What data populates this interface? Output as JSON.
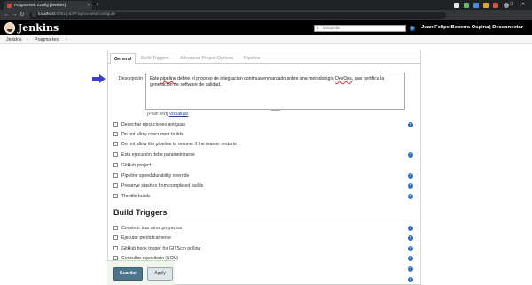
{
  "browser": {
    "tab_title": "Pragma-test Config [Jenkins]",
    "tab_close": "×",
    "new_tab": "+",
    "window_controls": [
      "—",
      "☐",
      "✕"
    ],
    "url_host": "localhost",
    "url_path": ":8081/job/Pragma-test/configure",
    "back": "←",
    "forward": "→",
    "reload": "↻",
    "info_icon": "ⓘ"
  },
  "header": {
    "logo_text": "Jenkins",
    "search_placeholder": "búsqueda",
    "search_icon": "⌕",
    "help": "?",
    "user": "Juan Felipe Becerra Ospina",
    "logout": "| Desconectar"
  },
  "breadcrumb": {
    "items": [
      "Jenkins",
      "Pragma-test"
    ],
    "separator": "›"
  },
  "tabs": [
    "General",
    "Build Triggers",
    "Advanced Project Options",
    "Pipeline"
  ],
  "description": {
    "label": "Descripción",
    "text_parts": [
      "Este ",
      "pipeline",
      " define el proceso de integración continua enmarcado sobre una metodología ",
      "DevOps",
      ", que certifica la generación de software de calidad."
    ],
    "plain_text": "[Plain text]",
    "preview": "Visualizar"
  },
  "general_options": [
    "Desechar ejecuciones antiguas",
    "Do not allow concurrent builds",
    "Do not allow the pipeline to resume if the master restarts",
    "Esta ejecución debe parametrizarse",
    "GitHub project",
    "Pipeline speed/durability override",
    "Preserve stashes from completed builds",
    "Throttle builds"
  ],
  "build_triggers": {
    "title": "Build Triggers",
    "options": [
      "Construir tras otros proyectos",
      "Ejecutar periódicamente",
      "GitHub hook trigger for GITScm polling",
      "Consultar repositorio (SCM)"
    ]
  },
  "buttons": {
    "save": "Guardar",
    "apply": "Apply"
  }
}
